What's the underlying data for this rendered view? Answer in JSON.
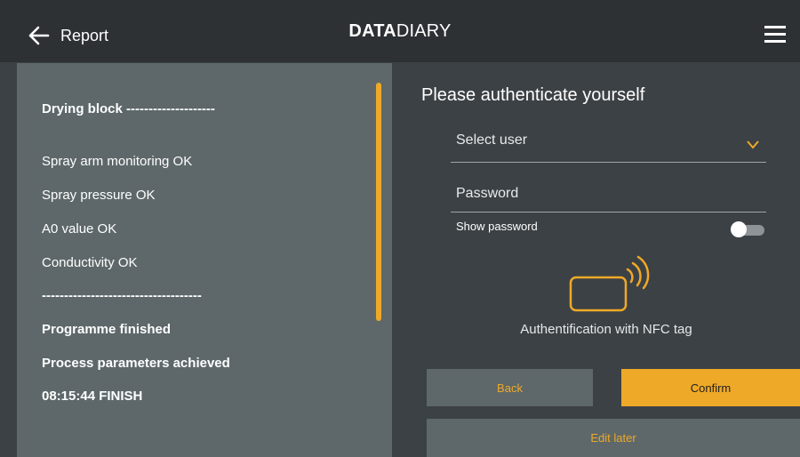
{
  "header": {
    "back_label": "Report",
    "logo_bold": "DATA",
    "logo_light": "DIARY"
  },
  "report": {
    "lines": [
      "Drying block --------------------",
      "Spray arm monitoring OK",
      "Spray pressure OK",
      "A0 value OK",
      "Conductivity OK",
      "------------------------------------",
      "Programme finished",
      "Process parameters achieved",
      "08:15:44 FINISH"
    ]
  },
  "auth": {
    "title": "Please authenticate yourself",
    "select_user_placeholder": "Select user",
    "password_placeholder": "Password",
    "show_password_label": "Show password",
    "show_password_enabled": false,
    "nfc_caption": "Authentification with NFC tag"
  },
  "buttons": {
    "back": "Back",
    "confirm": "Confirm",
    "edit_later": "Edit later"
  },
  "colors": {
    "accent": "#efa928",
    "header_bg": "#2e3134",
    "page_bg": "#3c4145",
    "panel_bg": "#5e686a"
  }
}
